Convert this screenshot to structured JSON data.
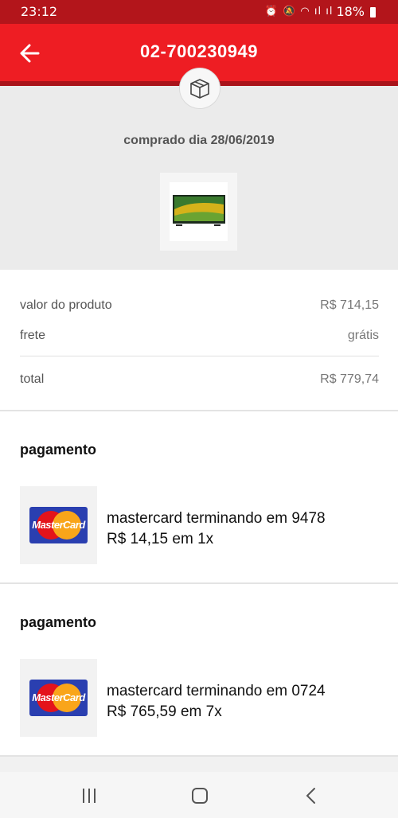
{
  "status_bar": {
    "time": "23:12",
    "indicators": "⏰ 🔕 ◠ ıl ıl",
    "battery_percent": "18%",
    "icons": [
      "alarm-icon",
      "mute-icon",
      "wifi-icon",
      "signal-icon",
      "signal-icon",
      "battery-icon"
    ]
  },
  "header": {
    "title": "02-700230949",
    "back_icon": "arrow-left-icon",
    "background": "#ee1d23"
  },
  "summary": {
    "icon": "box-icon",
    "purchase_date": "comprado dia 28/06/2019",
    "product_image": "tv-icon"
  },
  "prices": {
    "product_label": "valor do produto",
    "product_value": "R$ 714,15",
    "shipping_label": "frete",
    "shipping_value": "grátis",
    "total_label": "total",
    "total_value": "R$ 779,74"
  },
  "payments": [
    {
      "heading": "pagamento",
      "card_brand_logo": "MasterCard",
      "card_line": "mastercard terminando em 9478",
      "amount_line": "R$ 14,15 em 1x"
    },
    {
      "heading": "pagamento",
      "card_brand_logo": "MasterCard",
      "card_line": "mastercard terminando em 0724",
      "amount_line": "R$ 765,59 em 7x"
    }
  ],
  "nav_bar": {
    "icons": [
      "recent-apps-icon",
      "home-icon",
      "back-icon"
    ]
  }
}
